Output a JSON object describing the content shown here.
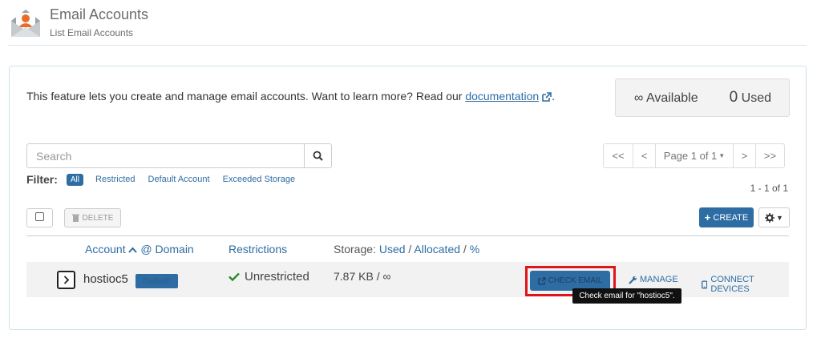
{
  "header": {
    "title": "Email Accounts",
    "subtitle": "List Email Accounts",
    "icon": "email-accounts-icon"
  },
  "intro": {
    "text": "This feature lets you create and manage email accounts. Want to learn more? Read our ",
    "link_label": "documentation",
    "suffix": "."
  },
  "stats": {
    "available_symbol": "∞",
    "available_label": "Available",
    "used_value": "0",
    "used_label": "Used"
  },
  "search": {
    "placeholder": "Search"
  },
  "pager": {
    "first": "<<",
    "prev": "<",
    "page_label": "Page 1 of 1",
    "next": ">",
    "last": ">>"
  },
  "filter": {
    "label": "Filter:",
    "options": [
      "All",
      "Restricted",
      "Default Account",
      "Exceeded Storage"
    ],
    "active": "All"
  },
  "count_label": "1 - 1 of 1",
  "toolbar": {
    "delete_label": "DELETE",
    "create_label": "CREATE"
  },
  "table": {
    "headers": {
      "account": "Account",
      "sort_separator": "@ Domain",
      "restrictions": "Restrictions",
      "storage_prefix": "Storage:",
      "storage_used": "Used",
      "storage_allocated": "Allocated",
      "storage_percent": "%"
    },
    "rows": [
      {
        "account": "hostioc5",
        "badge": "Default",
        "restriction": "Unrestricted",
        "storage": "7.87 KB / ∞",
        "actions": {
          "check_email": "CHECK EMAIL",
          "manage": "MANAGE",
          "connect": "CONNECT DEVICES"
        }
      }
    ]
  },
  "tooltip": "Check email for \"hostioc5\".",
  "colors": {
    "accent": "#2e6da4",
    "highlight": "#e0141b",
    "success": "#2d8a2d",
    "icon_orange": "#e96c2a"
  }
}
